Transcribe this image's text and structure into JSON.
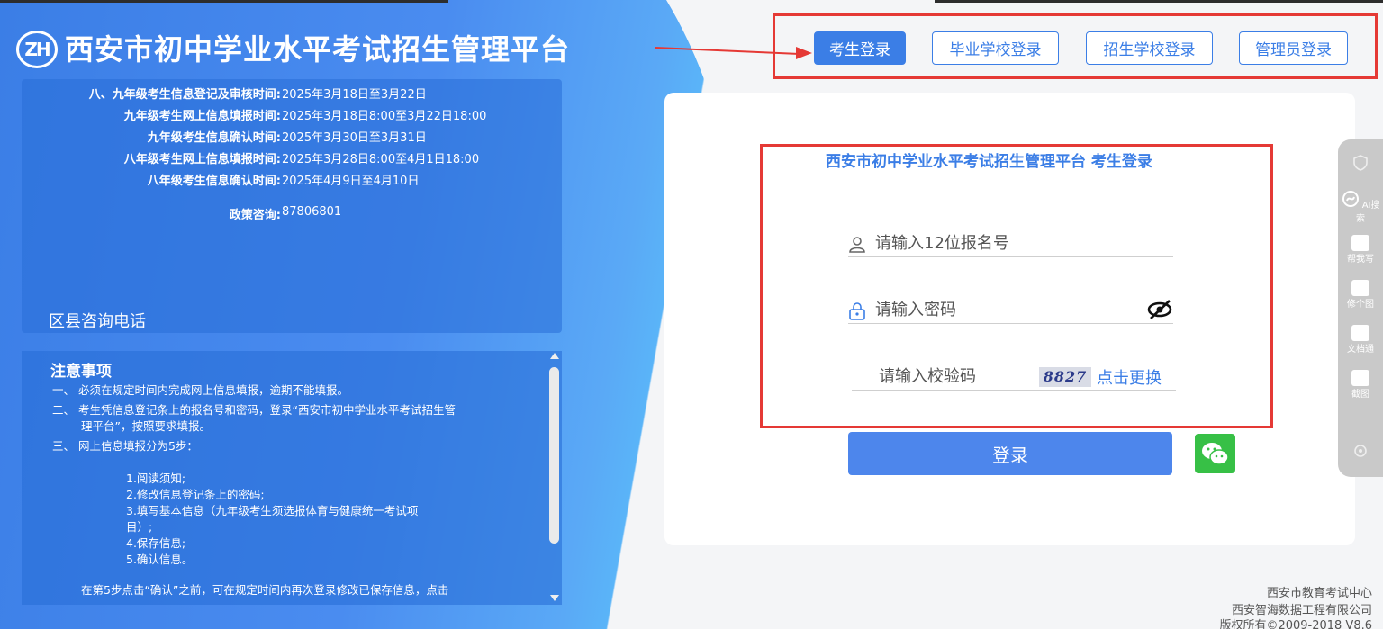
{
  "app": {
    "logo_text": "ZH",
    "title": "西安市初中学业水平考试招生管理平台"
  },
  "info": {
    "rows": [
      {
        "label": "八、九年级考生信息登记及审核时间:",
        "value": "2025年3月18日至3月22日"
      },
      {
        "label": "九年级考生网上信息填报时间:",
        "value": "2025年3月18日8:00至3月22日18:00"
      },
      {
        "label": "九年级考生信息确认时间:",
        "value": "2025年3月30日至3月31日"
      },
      {
        "label": "八年级考生网上信息填报时间:",
        "value": "2025年3月28日8:00至4月1日18:00"
      },
      {
        "label": "八年级考生信息确认时间:",
        "value": "2025年4月9日至4月10日"
      },
      {
        "label": "政策咨询:",
        "value": "87806801"
      }
    ],
    "district_heading": "区县咨询电话"
  },
  "notice": {
    "title": "注意事项",
    "items": [
      "一、 必须在规定时间内完成网上信息填报，逾期不能填报。",
      "二、 考生凭信息登记条上的报名号和密码，登录“西安市初中学业水平考试招生管",
      "理平台”，按照要求填报。",
      "三、 网上信息填报分为5步：",
      "1.阅读须知;",
      "2.修改信息登记条上的密码;",
      "3.填写基本信息（九年级考生须选报体育与健康统一考试项",
      "目）;",
      "4.保存信息;",
      "5.确认信息。",
      "在第5步点击“确认”之前，可在规定时间内再次登录修改已保存信息，点击"
    ]
  },
  "nav": {
    "tabs": [
      {
        "label": "考生登录",
        "active": true
      },
      {
        "label": "毕业学校登录",
        "active": false
      },
      {
        "label": "招生学校登录",
        "active": false
      },
      {
        "label": "管理员登录",
        "active": false
      }
    ]
  },
  "login": {
    "form_title": "西安市初中学业水平考试招生管理平台 考生登录",
    "username_placeholder": "请输入12位报名号",
    "password_placeholder": "请输入密码",
    "captcha_placeholder": "请输入校验码",
    "captcha_text": "8827",
    "captcha_refresh": "点击更换",
    "submit_label": "登录"
  },
  "sidebar": {
    "items": [
      {
        "label": "",
        "icon": "shield-icon"
      },
      {
        "label": "AI搜索",
        "icon": "ai-search-icon"
      },
      {
        "label": "帮我写",
        "icon": "write-icon"
      },
      {
        "label": "修个图",
        "icon": "image-edit-icon"
      },
      {
        "label": "文档通",
        "icon": "document-icon"
      },
      {
        "label": "截图",
        "icon": "camera-icon"
      },
      {
        "label": "",
        "icon": "settings-icon"
      }
    ]
  },
  "footer": {
    "lines": [
      "西安市教育考试中心",
      "西安智海数据工程有限公司",
      "版权所有©2009-2018 V8.6"
    ]
  },
  "colors": {
    "accent": "#3b7ee6",
    "annotation_red": "#e53935",
    "wechat_green": "#37c046"
  }
}
